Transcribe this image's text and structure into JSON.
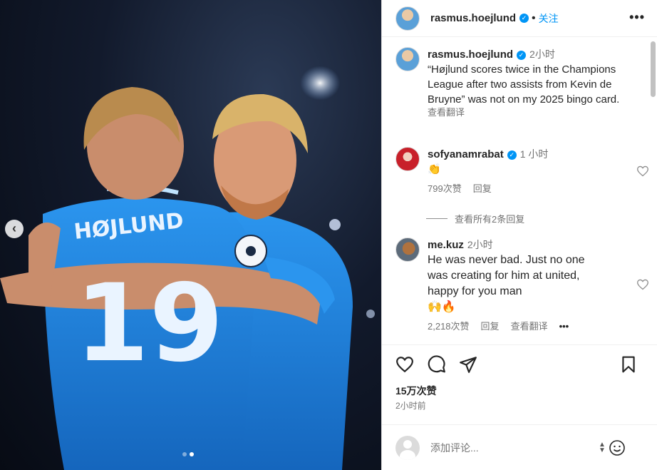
{
  "post": {
    "username": "rasmus.hoejlund",
    "follow_label": "关注",
    "more_label": "•••",
    "dot_separator": "•"
  },
  "caption": {
    "username": "rasmus.hoejlund",
    "time": "2小时",
    "text": "“Højlund scores twice in the Champions League after two assists from Kevin de Bruyne” was not on my 2025 bingo card.",
    "translate_label": "查看翻译"
  },
  "comments": [
    {
      "username": "sofyanamrabat",
      "time": "1 小时",
      "text": "👏",
      "likes": "799次赞",
      "reply_label": "回复",
      "view_replies_label": "查看所有2条回复"
    },
    {
      "username": "me.kuz",
      "time": "2小时",
      "text": "He was never bad. Just no one was creating for him at united, happy for you man",
      "emojis": "🙌🔥",
      "likes": "2,218次赞",
      "reply_label": "回复",
      "translate_label": "查看翻译",
      "more_label": "•••"
    }
  ],
  "footer": {
    "likes": "15万次赞",
    "post_time": "2小时前"
  },
  "compose": {
    "placeholder": "添加评论..."
  },
  "photo": {
    "jersey_name": "HØJLUND",
    "jersey_number": "19"
  },
  "colors": {
    "accent": "#0095f6",
    "jersey": "#1f86e0"
  }
}
